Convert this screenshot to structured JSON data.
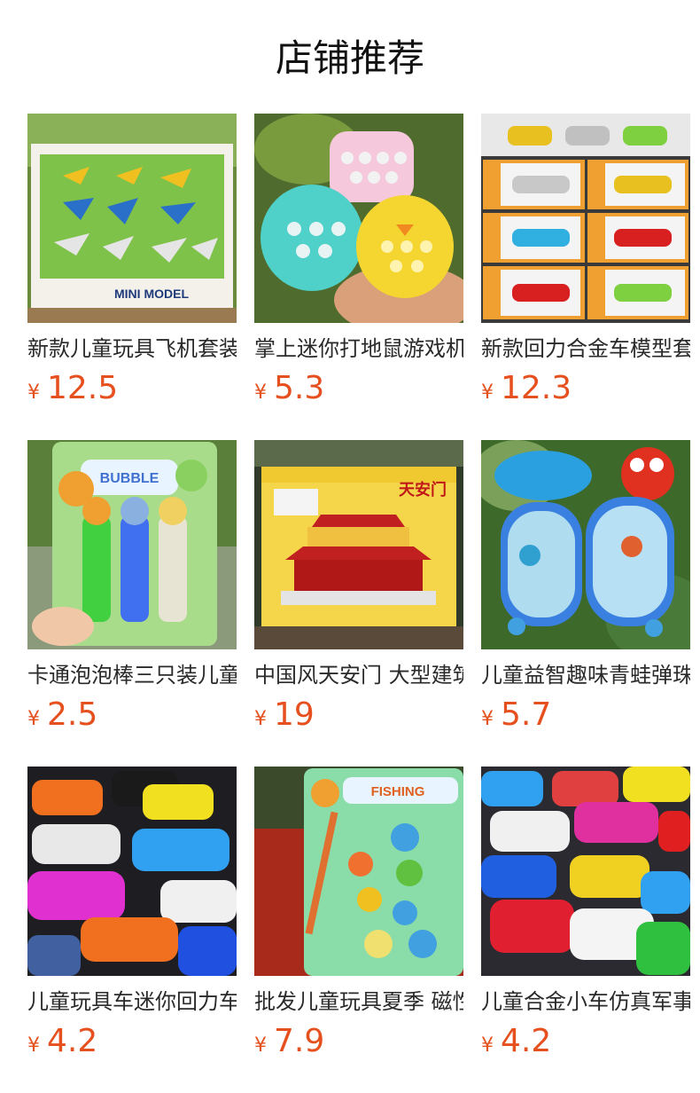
{
  "header": {
    "title": "店铺推荐"
  },
  "colors": {
    "price": "#e6501e",
    "text": "#2a2a2a"
  },
  "products": [
    {
      "title": "新款儿童玩具飞机套装",
      "currency": "¥",
      "price": "12.5",
      "image": "airplane-set-image",
      "box_text": "MINI MODEL"
    },
    {
      "title": "掌上迷你打地鼠游戏机",
      "currency": "¥",
      "price": "5.3",
      "image": "whack-a-mole-toy-image"
    },
    {
      "title": "新款回力合金车模型套装",
      "currency": "¥",
      "price": "12.3",
      "image": "diecast-car-set-image"
    },
    {
      "title": "卡通泡泡棒三只装儿童",
      "currency": "¥",
      "price": "2.5",
      "image": "bubble-wand-image",
      "box_text": "BUBBLE"
    },
    {
      "title": "中国风天安门 大型建筑积木",
      "currency": "¥",
      "price": "19",
      "image": "tiananmen-blocks-image",
      "box_text": "天安门"
    },
    {
      "title": "儿童益智趣味青蛙弹珠",
      "currency": "¥",
      "price": "5.7",
      "image": "pinball-game-image"
    },
    {
      "title": "儿童玩具车迷你回力车",
      "currency": "¥",
      "price": "4.2",
      "image": "pullback-cars-image"
    },
    {
      "title": "批发儿童玩具夏季 磁性钓鱼",
      "currency": "¥",
      "price": "7.9",
      "image": "fishing-toy-image",
      "box_text": "FISHING"
    },
    {
      "title": "儿童合金小车仿真军事",
      "currency": "¥",
      "price": "4.2",
      "image": "alloy-cars-image"
    }
  ]
}
